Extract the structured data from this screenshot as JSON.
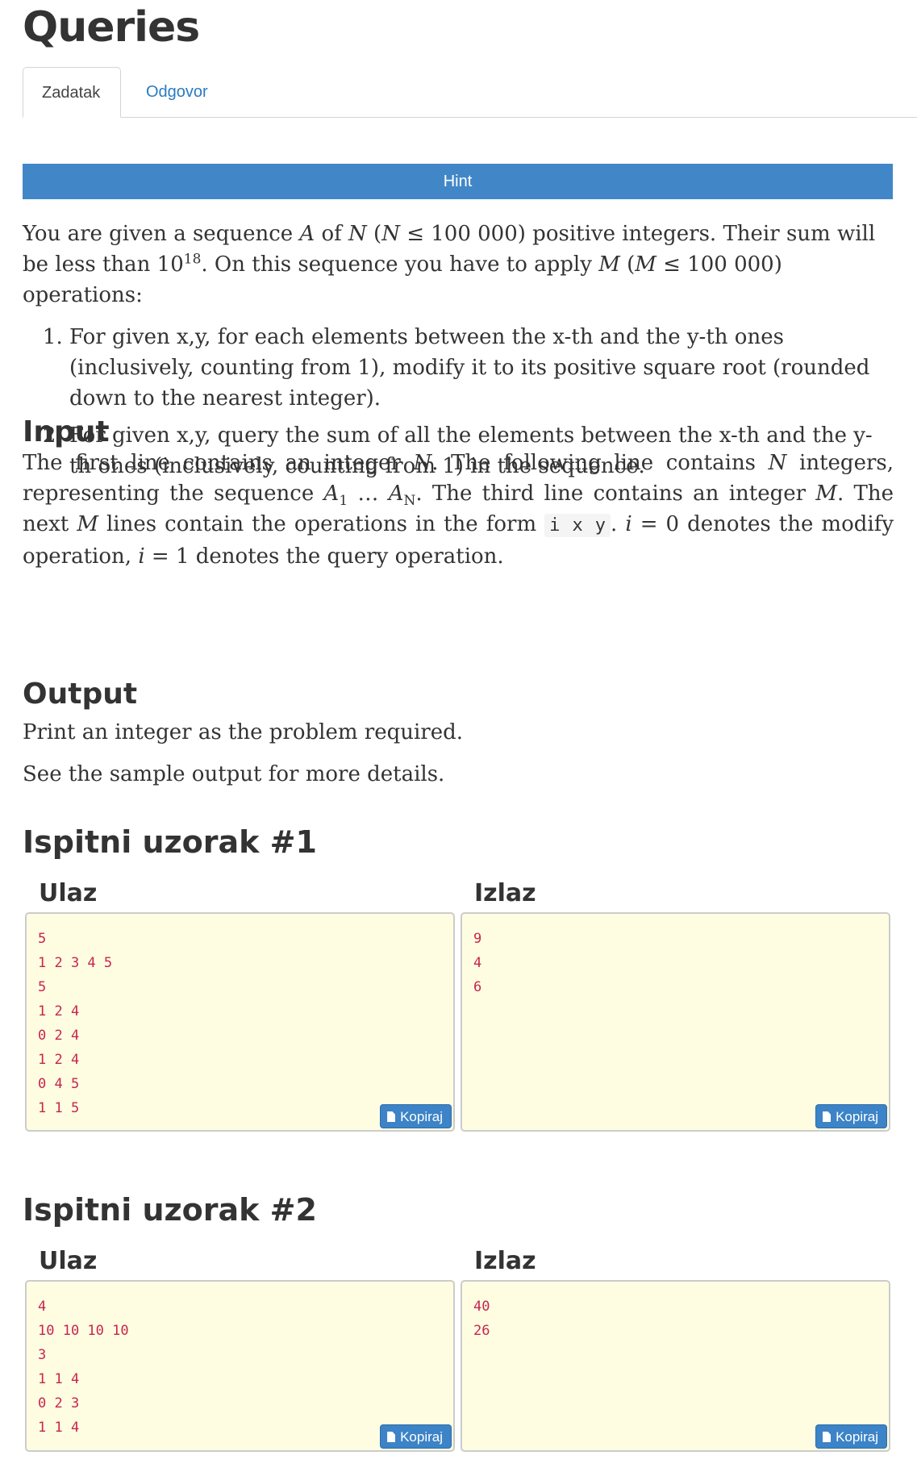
{
  "title": "Queries",
  "tabs": [
    {
      "label": "Zadatak",
      "active": true
    },
    {
      "label": "Odgovor",
      "active": false
    }
  ],
  "hint_label": "Hint",
  "statement": {
    "p1_a": "You are given a sequence ",
    "p1_A": "A",
    "p1_b": " of ",
    "p1_N": "N",
    "p1_c": " (",
    "p1_N2": "N",
    "p1_d": " ≤ 100 000) positive integers. Their sum will be less than 10",
    "p1_exp": "18",
    "p1_e": ". On this sequence you have to apply ",
    "p1_M": "M",
    "p1_f": " (",
    "p1_M2": "M",
    "p1_g": " ≤ 100 000) operations:",
    "items": [
      "For given x,y, for each elements between the x-th and the y-th ones (inclusively, counting from 1), modify it to its positive square root (rounded down to the nearest integer).",
      "For given x,y, query the sum of all the elements between the x-th and the y-th ones (inclusively, counting from 1) in the sequence."
    ]
  },
  "input": {
    "heading": "Input",
    "t1": "The first line contains an integer ",
    "N": "N",
    "t2": ". The following line contains ",
    "N2": "N",
    "t3": " integers, representing the sequence ",
    "A1": "A",
    "sub1": "1",
    "dots": " … ",
    "AN": "A",
    "subN": "N",
    "t4": ". The third line contains an integer ",
    "M": "M",
    "t5": ". The next ",
    "M2": "M",
    "t6": " lines contain the operations in the form ",
    "code": "i x y",
    "t7": ". ",
    "i0": "i",
    "t8": " = 0 denotes the modify operation, ",
    "i1": "i",
    "t9": " = 1 denotes the query operation."
  },
  "output": {
    "heading": "Output",
    "p1": "Print an integer as the problem required.",
    "p2": "See the sample output for more details."
  },
  "samples": [
    {
      "heading": "Ispitni uzorak #1",
      "input_label": "Ulaz",
      "output_label": "Izlaz",
      "input": "5\n1 2 3 4 5\n5\n1 2 4\n0 2 4\n1 2 4\n0 4 5\n1 1 5",
      "output": "9\n4\n6",
      "copy_label": "Kopiraj"
    },
    {
      "heading": "Ispitni uzorak #2",
      "input_label": "Ulaz",
      "output_label": "Izlaz",
      "input": "4\n10 10 10 10\n3\n1 1 4\n0 2 3\n1 1 4",
      "output": "40\n26",
      "copy_label": "Kopiraj"
    }
  ],
  "colors": {
    "hint_bar": "#4187c8",
    "link": "#2a7bc0",
    "sample_bg": "#fefde2",
    "sample_text": "#c7254e",
    "copy_button": "#3c83c7"
  },
  "icons": {
    "copy": "document-icon"
  }
}
